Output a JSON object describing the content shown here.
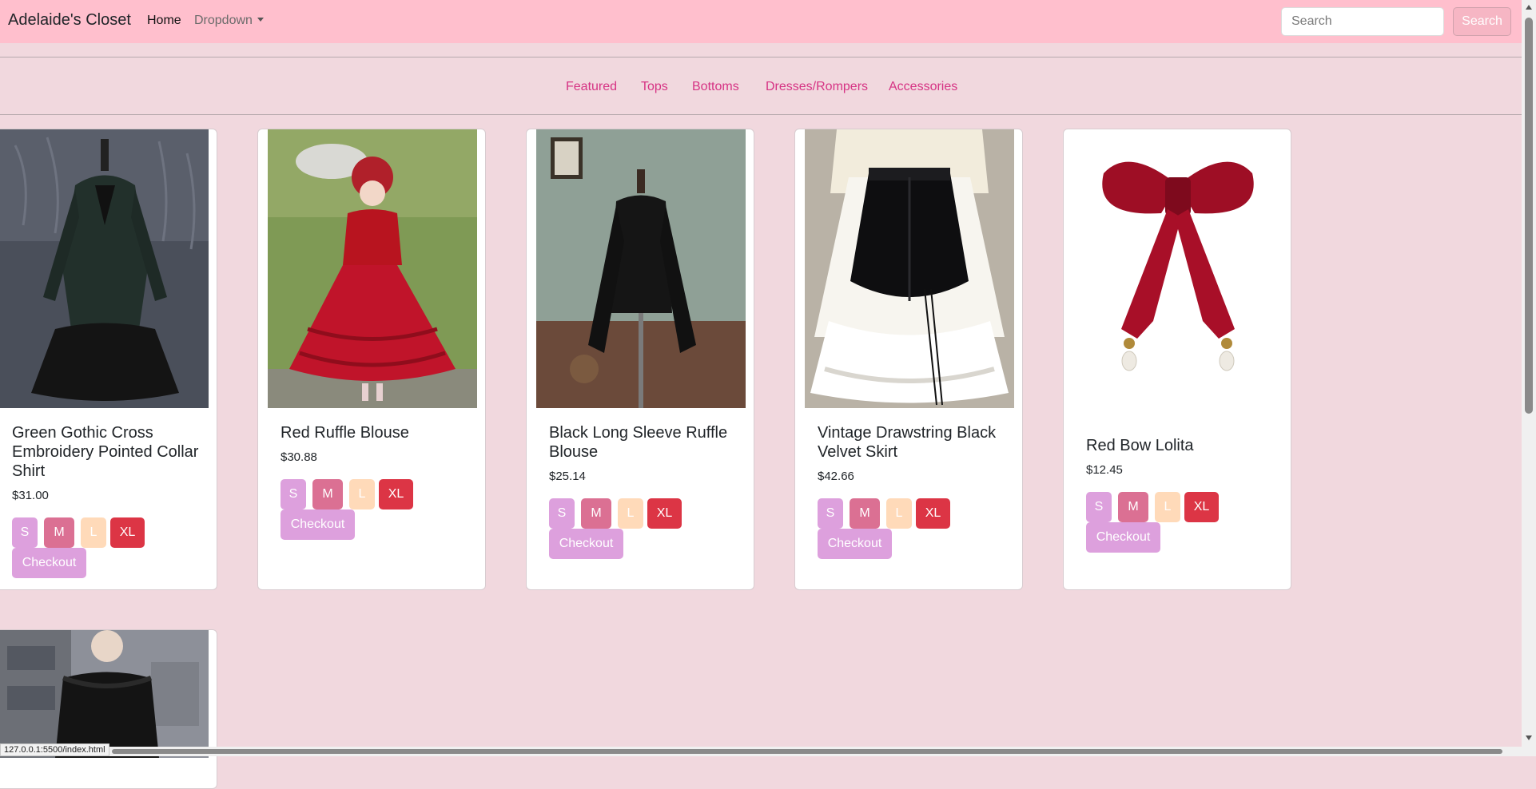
{
  "navbar": {
    "brand": "Adelaide's Closet",
    "home": "Home",
    "dropdown": "Dropdown",
    "search_placeholder": "Search",
    "search_button": "Search"
  },
  "categories": [
    "Featured",
    "Tops",
    "Bottoms",
    "Dresses/Rompers",
    "Accessories"
  ],
  "sizes": [
    "S",
    "M",
    "L",
    "XL"
  ],
  "size_colors": {
    "S": "#dda0dd",
    "M": "#db7093",
    "L": "#ffdab9",
    "XL": "#dc3545"
  },
  "checkout_label": "Checkout",
  "products": [
    {
      "title": "Green Gothic Cross Embroidery Pointed Collar Shirt",
      "price": "$31.00"
    },
    {
      "title": "Red Ruffle Blouse",
      "price": "$30.88"
    },
    {
      "title": "Black Long Sleeve Ruffle Blouse",
      "price": "$25.14"
    },
    {
      "title": "Vintage Drawstring Black Velvet Skirt",
      "price": "$42.66"
    },
    {
      "title": "Red Bow Lolita",
      "price": "$12.45"
    }
  ],
  "status_bar": {
    "url": "127.0.0.1:5500/index.html"
  },
  "colors": {
    "navbar": "#ffbfcd",
    "page_bg": "#f1d8de",
    "category_link": "#d63384"
  }
}
